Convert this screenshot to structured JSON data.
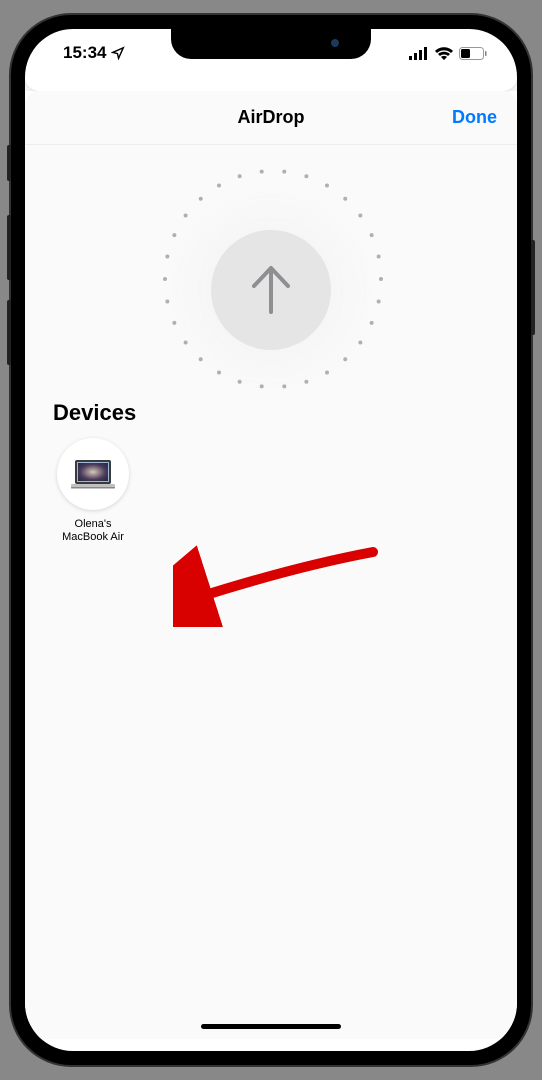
{
  "status_bar": {
    "time": "15:34"
  },
  "sheet": {
    "title": "AirDrop",
    "done_label": "Done"
  },
  "section": {
    "title": "Devices"
  },
  "devices": [
    {
      "name": "Olena's\nMacBook Air"
    }
  ],
  "colors": {
    "accent_blue": "#007aff",
    "annotation_red": "#d90000"
  }
}
